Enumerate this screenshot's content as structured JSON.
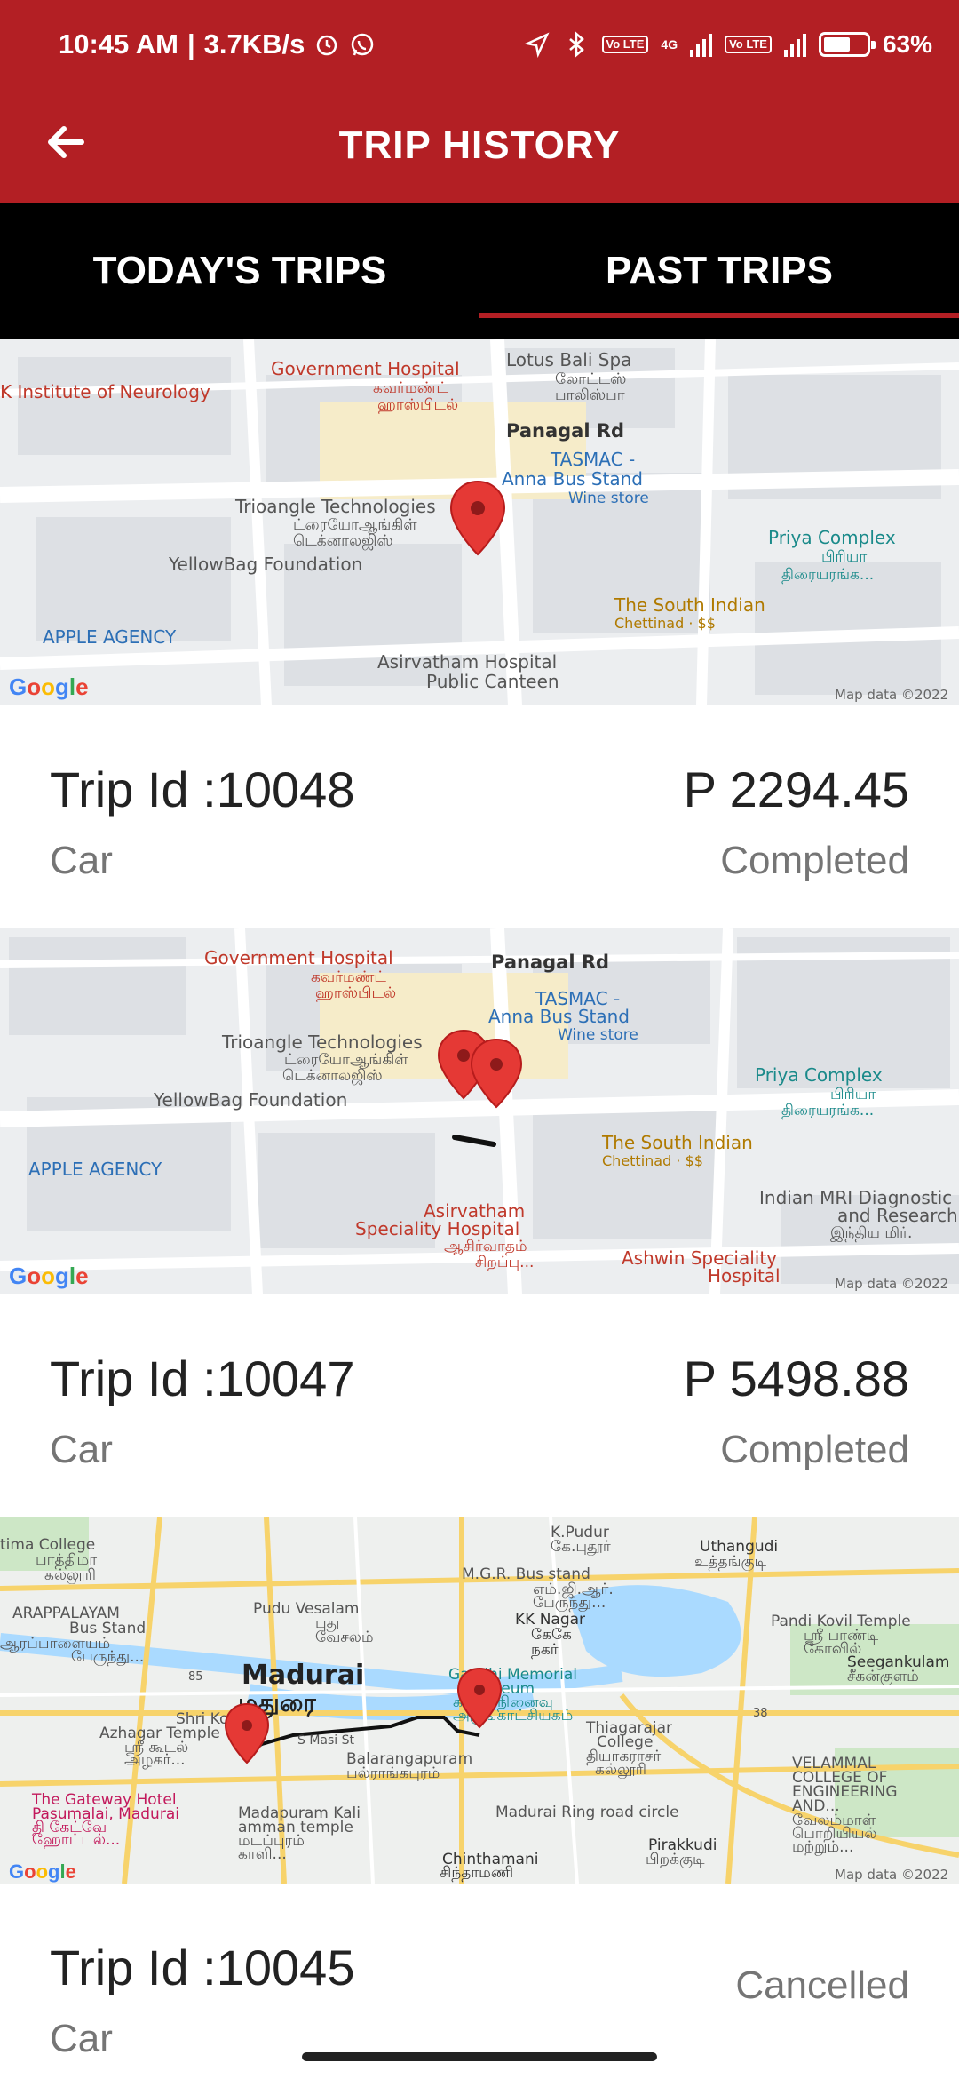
{
  "status_bar": {
    "time": "10:45 AM",
    "net_speed": "3.7KB/s",
    "lte1": "Vo LTE",
    "net_type": "4G",
    "lte2": "Vo LTE",
    "battery_percent": 63,
    "battery_label": "63%"
  },
  "app_bar": {
    "title": "TRIP HISTORY"
  },
  "tabs": [
    {
      "label": "TODAY'S TRIPS",
      "active": false
    },
    {
      "label": "PAST TRIPS",
      "active": true
    }
  ],
  "trips": [
    {
      "trip_id_label": "Trip Id :10048",
      "fare": "P 2294.45",
      "vehicle": "Car",
      "status": "Completed",
      "map": {
        "labels": [
          "Government Hospital",
          "கவர்மண்ட்",
          "ஹாஸ்பிடல்",
          "Lotus Bali Spa",
          "லோட்டஸ்",
          "பாலிஸ்பா",
          "Panagal Rd",
          "K Institute of Neurology",
          "TASMAC -",
          "Anna Bus Stand",
          "Wine store",
          "Trioangle Technologies",
          "ட்ரையோஆங்கிள்",
          "டெக்னாலஜிஸ்",
          "Priya Complex",
          "பிரியா",
          "திரையரங்க...",
          "YellowBag Foundation",
          "The South Indian",
          "Chettinad · $$",
          "APPLE AGENCY",
          "Asirvatham Hospital",
          "Public Canteen"
        ],
        "attribution": "Map data ©2022"
      }
    },
    {
      "trip_id_label": "Trip Id :10047",
      "fare": "P 5498.88",
      "vehicle": "Car",
      "status": "Completed",
      "map": {
        "labels": [
          "Government Hospital",
          "கவர்மண்ட்",
          "ஹாஸ்பிடல்",
          "Panagal Rd",
          "TASMAC -",
          "Anna Bus Stand",
          "Wine store",
          "Trioangle Technologies",
          "ட்ரையோஆங்கிள்",
          "டெக்னாலஜிஸ்",
          "Priya Complex",
          "பிரியா",
          "திரையரங்க...",
          "YellowBag Foundation",
          "The South Indian",
          "Chettinad · $$",
          "APPLE AGENCY",
          "Indian MRI Diagnostic",
          "and Research",
          "இந்திய மிர்.",
          "Asirvatham",
          "Speciality Hospital",
          "ஆசிர்வாதம்",
          "சிறப்பு...",
          "Ashwin Speciality",
          "Hospital"
        ],
        "attribution": "Map data ©2022"
      }
    },
    {
      "trip_id_label": "Trip Id :10045",
      "fare": "",
      "vehicle": "Car",
      "status": "Cancelled",
      "map": {
        "labels": [
          "K.Pudur",
          "கே.புதூர்",
          "Uthangudi",
          "உத்தங்குடி",
          "tima College",
          "பாத்திமா",
          "கல்லூரி",
          "M.G.R. Bus stand",
          "எம்.ஜி.ஆர்.",
          "பேருந்து...",
          "ARAPPALAYAM",
          "Bus Stand",
          "ஆரப்பாளையம்",
          "பேருந்து...",
          "Pudu Vesalam",
          "புது",
          "வேசலம்",
          "KK Nagar",
          "கேகே",
          "நகர்",
          "Pandi Kovil Temple",
          "ஸ்ரீ பாண்டி",
          "கோவில்",
          "Seegankulam",
          "சீகன்குளம்",
          "Madurai",
          "மதுரை",
          "Gandhi Memorial",
          "Museum",
          "காந்தி நினைவு",
          "அருங்காட்சியகம்",
          "Shri Koodal",
          "Azhagar Temple",
          "ஸ்ரீ கூடல்",
          "அழகர்...",
          "S Masi St",
          "Balarangapuram",
          "பல்ராங்கபுரம்",
          "Thiagarajar",
          "College",
          "தியாகராசர்",
          "கல்லூரி",
          "VELAMMAL",
          "COLLEGE OF",
          "ENGINEERING",
          "AND...",
          "வேலம்மாள்",
          "பொறியியல்",
          "மற்றும்...",
          "The Gateway Hotel",
          "Pasumalai, Madurai",
          "தி கேட்வே",
          "ஹோட்டல்...",
          "Madapuram Kali",
          "amman temple",
          "மடப்புரம்",
          "காளி...",
          "Madurai Ring road circle",
          "Chinthamani",
          "சிந்தாமணி",
          "Pirakkudi",
          "பிறக்குடி",
          "85",
          "38"
        ],
        "attribution": "Map data ©2022"
      }
    }
  ],
  "colors": {
    "brand_red": "#b31f24",
    "tab_bar": "#000000",
    "text_primary": "#222222",
    "text_secondary": "#757575"
  }
}
